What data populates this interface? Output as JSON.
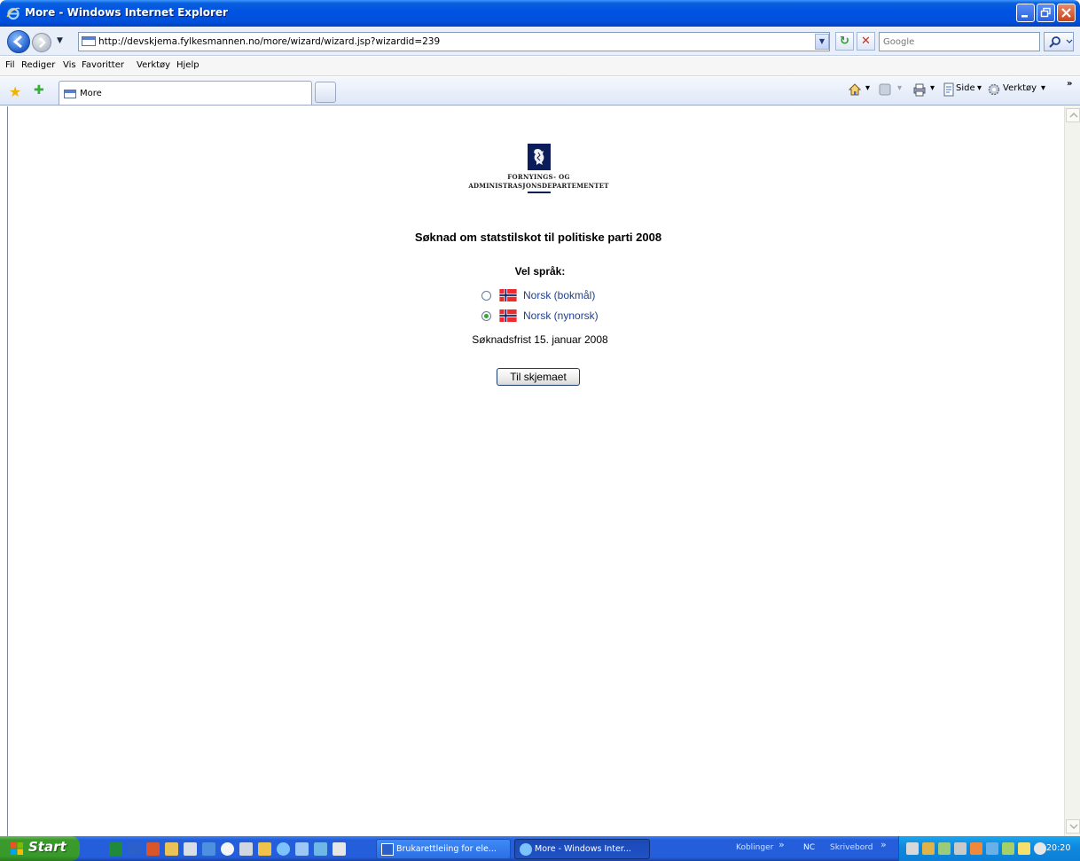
{
  "window": {
    "title": "More - Windows Internet Explorer"
  },
  "address_bar": {
    "url": "http://devskjema.fylkesmannen.no/more/wizard/wizard.jsp?wizardid=239",
    "search_placeholder": "Google"
  },
  "menu": {
    "items": [
      "Fil",
      "Rediger",
      "Vis",
      "Favoritter",
      "Verktøy",
      "Hjelp"
    ]
  },
  "tabs": [
    {
      "label": "More"
    }
  ],
  "command_bar": {
    "page_label": "Side",
    "tools_label": "Verktøy"
  },
  "page": {
    "logo": {
      "line1": "FORNYINGS- OG",
      "line2": "ADMINISTRASJONSDEPARTEMENTET",
      "icon": "coat-of-arms-lion"
    },
    "title": "Søknad om statstilskot til politiske parti 2008",
    "language_label": "Vel språk:",
    "languages": [
      {
        "label": "Norsk (bokmål)",
        "selected": false
      },
      {
        "label": "Norsk (nynorsk)",
        "selected": true
      }
    ],
    "deadline": "Søknadsfrist 15. januar 2008",
    "submit_label": "Til skjemaet"
  },
  "taskbar": {
    "start_label": "Start",
    "windows": [
      {
        "label": "Brukarettleiing for ele...",
        "icon": "word-icon",
        "active": false
      },
      {
        "label": "More - Windows Inter...",
        "icon": "ie-icon",
        "active": true
      }
    ],
    "toolbars": [
      "Koblinger",
      "NC",
      "Skrivebord"
    ],
    "clock": "20:20"
  },
  "colors": {
    "title_bar": "#0054e3",
    "taskbar": "#245edb",
    "start_button": "#379a2a",
    "link": "#1f3f8f",
    "logo_navy": "#0b1d5a"
  }
}
